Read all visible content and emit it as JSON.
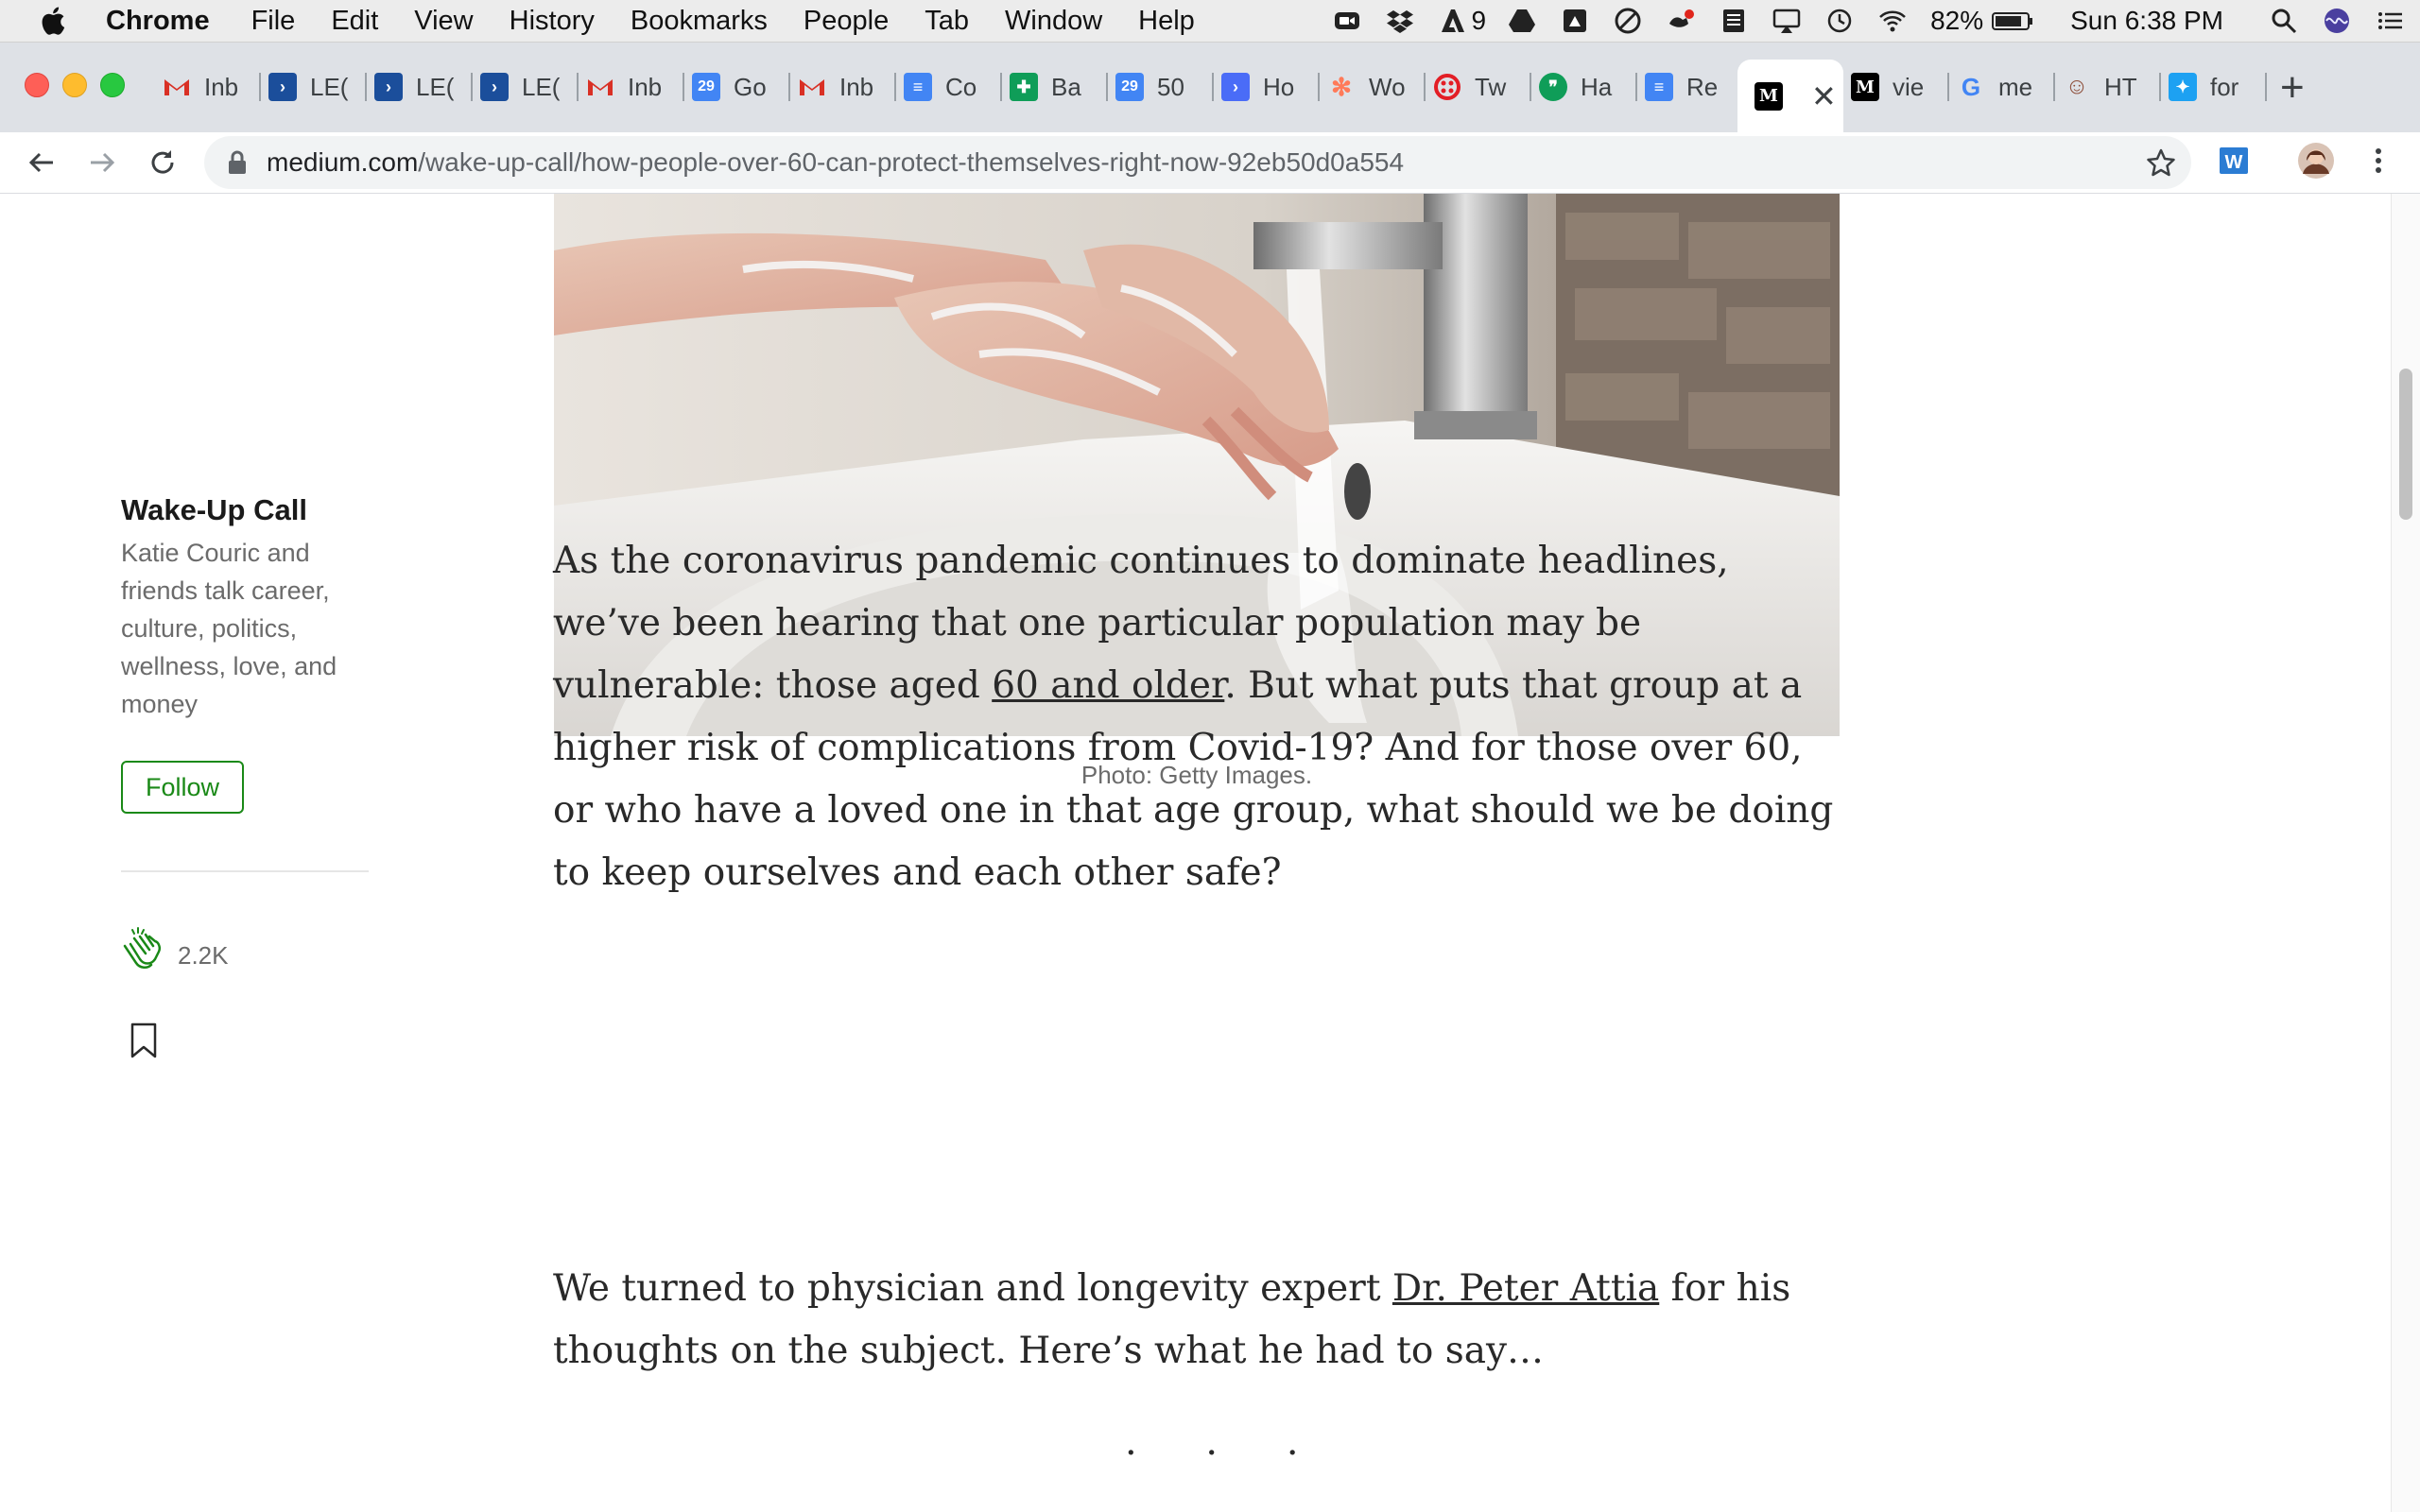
{
  "menubar": {
    "app_name": "Chrome",
    "items": [
      "File",
      "Edit",
      "View",
      "History",
      "Bookmarks",
      "People",
      "Tab",
      "Window",
      "Help"
    ],
    "status_icons": [
      "zoom-icon",
      "dropbox-icon",
      "adobe-icon",
      "drive-icon",
      "drive-file-icon",
      "focus-icon",
      "keyboard-icon",
      "notes-icon",
      "airplay-icon",
      "time-machine-icon",
      "wifi-icon",
      "battery-icon",
      "search-icon",
      "siri-icon",
      "menu-list-icon"
    ],
    "adobe_count": "9",
    "battery": "82%",
    "clock": "Sun 6:38 PM"
  },
  "tabs": [
    {
      "label": "Inb",
      "icon": "gmail-icon",
      "color": "#d93025"
    },
    {
      "label": "LE(",
      "icon": "chevron-app-icon",
      "color": "#1b4e9b"
    },
    {
      "label": "LE(",
      "icon": "chevron-app-icon",
      "color": "#1b4e9b"
    },
    {
      "label": "LE(",
      "icon": "chevron-app-icon",
      "color": "#1b4e9b"
    },
    {
      "label": "Inb",
      "icon": "gmail-icon",
      "color": "#d93025"
    },
    {
      "label": "Go",
      "icon": "calendar-icon",
      "color": "#4285f4",
      "glyph": "29"
    },
    {
      "label": "Inb",
      "icon": "gmail-icon",
      "color": "#d93025"
    },
    {
      "label": "Co",
      "icon": "docs-icon",
      "color": "#4285f4"
    },
    {
      "label": "Ba",
      "icon": "sheets-icon",
      "color": "#0f9d58"
    },
    {
      "label": "50",
      "icon": "calendar-icon",
      "color": "#4285f4",
      "glyph": "29"
    },
    {
      "label": "Ho",
      "icon": "chevron-app-icon",
      "color": "#4a6cf7"
    },
    {
      "label": "Wo",
      "icon": "hubspot-icon",
      "color": "#ff7a59"
    },
    {
      "label": "Tw",
      "icon": "twilio-icon",
      "color": "#e31e26"
    },
    {
      "label": "Ha",
      "icon": "hangouts-icon",
      "color": "#0f9d58"
    },
    {
      "label": "Re",
      "icon": "docs-icon",
      "color": "#4285f4"
    },
    {
      "label": "",
      "icon": "medium-icon",
      "color": "#000000",
      "active": true
    },
    {
      "label": "vie",
      "icon": "medium-icon",
      "color": "#000000"
    },
    {
      "label": "me",
      "icon": "google-icon",
      "color": "#4285f4"
    },
    {
      "label": "HT",
      "icon": "face-icon",
      "color": "#8d4e3a"
    },
    {
      "label": "for",
      "icon": "bird-icon",
      "color": "#1da1f2"
    }
  ],
  "address": {
    "domain": "medium.com",
    "path": "/wake-up-call/how-people-over-60-can-protect-themselves-right-now-92eb50d0a554"
  },
  "sidebar": {
    "publication": "Wake-Up Call",
    "description": "Katie Couric and friends talk career, culture, politics, wellness, love, and money",
    "follow_label": "Follow",
    "claps": "2.2K"
  },
  "article": {
    "caption": "Photo: Getty Images.",
    "p1_a": "As the coronavirus pandemic continues to dominate headlines, we’ve been hearing that one particular population may be vulnerable: those aged ",
    "p1_link": "60 and older",
    "p1_b": ". But what puts that group at a higher risk of complications from Covid-19? And for those over 60, or who have a loved one in that age group, what should we be doing to keep ourselves and each other safe?",
    "p2_a": "We turned to physician and longevity expert ",
    "p2_link": "Dr. Peter Attia",
    "p2_b": " for his thoughts on the subject. Here’s what he had to say…",
    "separator": "· · ·"
  },
  "colors": {
    "medium_green": "#1a8917",
    "text": "#292929"
  }
}
